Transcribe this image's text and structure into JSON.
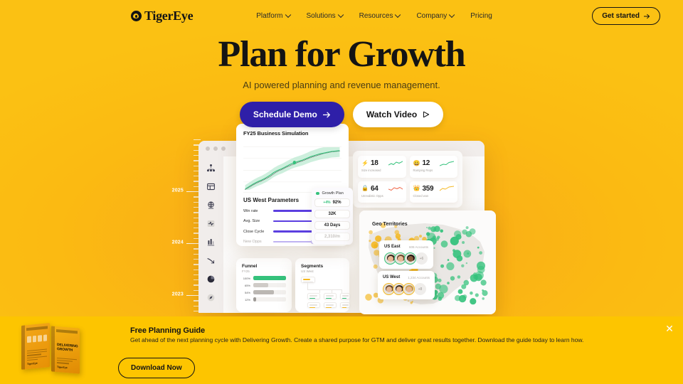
{
  "theme": {
    "bg_yellow": "#FBC113",
    "banner_yellow": "#FDC500",
    "accent_purple": "#2E1FA8",
    "accent_green": "#35C27C",
    "ink": "#141414"
  },
  "nav": {
    "brand": "TigerEye",
    "brand_icon": "tiger-eye-logo-icon",
    "links": [
      {
        "label": "Platform",
        "has_dropdown": true
      },
      {
        "label": "Solutions",
        "has_dropdown": true
      },
      {
        "label": "Resources",
        "has_dropdown": true
      },
      {
        "label": "Company",
        "has_dropdown": true
      },
      {
        "label": "Pricing",
        "has_dropdown": false
      }
    ],
    "cta": {
      "label": "Get started",
      "icon": "arrow-right-icon"
    }
  },
  "hero": {
    "title": "Plan for Growth",
    "subtitle": "AI powered planning and revenue management.",
    "primary_cta": {
      "label": "Schedule Demo",
      "icon": "arrow-right-icon"
    },
    "secondary_cta": {
      "label": "Watch Video",
      "icon": "play-icon"
    }
  },
  "timeline": {
    "labels": [
      "2025",
      "2024",
      "2023"
    ]
  },
  "dashboard": {
    "window_dots": 3,
    "rail_icons": [
      "org-chart-icon",
      "table-icon",
      "globe-target-icon",
      "pulse-activity-icon",
      "bar-chart-icon",
      "trend-down-icon",
      "pie-chart-icon",
      "compass-icon",
      "people-group-icon",
      "settings-gear-icon"
    ],
    "simulation": {
      "title": "FY25 Business Simulation",
      "chart": {
        "type": "line",
        "series_name": "Growth Plan",
        "band_color": "#B8E9CE",
        "line_color": "#35C27C",
        "actual_points": [
          2,
          8,
          14,
          19,
          23,
          28,
          34,
          41,
          46,
          50,
          55,
          60,
          64,
          67,
          70,
          74,
          78,
          81,
          84,
          86,
          88,
          90,
          91,
          92
        ],
        "plan_points": [
          1,
          6,
          12,
          17,
          21,
          26,
          31,
          38,
          44,
          48,
          53,
          57,
          61,
          65,
          68,
          72,
          76,
          79,
          82,
          85,
          87,
          89,
          90,
          91
        ],
        "marker_index": 12
      },
      "params_title": "US West Parameters",
      "legend_label": "Growth Plan",
      "parameters": [
        {
          "label": "Win rate",
          "fill_pct": 78,
          "delta": "+4%",
          "value": "92%",
          "muted": false
        },
        {
          "label": "Avg. Size",
          "fill_pct": 64,
          "delta": "",
          "value": "32K",
          "muted": false
        },
        {
          "label": "Close Cycle",
          "fill_pct": 82,
          "delta": "",
          "value": "43 Days",
          "muted": false
        },
        {
          "label": "New Opps",
          "fill_pct": 58,
          "delta": "",
          "value": "2,310/m",
          "muted": true
        }
      ]
    },
    "metrics": [
      {
        "icon": "lightning-bolt-icon",
        "glyph": "⚡",
        "value": "18",
        "label": "Size increased",
        "spark_color": "#35C27C"
      },
      {
        "icon": "smiley-face-icon",
        "glyph": "😀",
        "value": "12",
        "label": "Ramping Reps",
        "spark_color": "#35C27C"
      },
      {
        "icon": "lock-icon",
        "glyph": "🔒",
        "value": "64",
        "label": "Unrealistic Opps",
        "spark_color": "#F06A4B"
      },
      {
        "icon": "crown-icon",
        "glyph": "👑",
        "value": "359",
        "label": "Closed won",
        "spark_color": "#F5B820"
      }
    ],
    "funnel": {
      "title": "Funnel",
      "subtitle": "FY25",
      "rows": [
        {
          "pct_label": "100%",
          "width": 100,
          "color": "#35C27C"
        },
        {
          "pct_label": "65%",
          "width": 45,
          "color": "#CFCBC7"
        },
        {
          "pct_label": "54%",
          "width": 62,
          "color": "#BBB7B3"
        },
        {
          "pct_label": "12%",
          "width": 9,
          "color": "#9E9A96"
        }
      ]
    },
    "segments": {
      "title": "Segments",
      "subtitle": "US West"
    },
    "geo": {
      "title": "Geo Territories",
      "territories": [
        {
          "name": "US East",
          "accounts": "608 Accounts",
          "more": "+6",
          "ring": "green"
        },
        {
          "name": "US West",
          "accounts": "1,234 Accounts",
          "more": "+8",
          "ring": "yellow"
        }
      ]
    }
  },
  "banner": {
    "title": "Free Planning Guide",
    "description": "Get ahead of the next planning cycle with Delivering Growth. Create a shared purpose for GTM and deliver great results together. Download the guide today to learn how.",
    "cta": "Download Now",
    "close_icon": "close-icon",
    "book_title": "DELIVERING GROWTH",
    "book_brand": "TigerEye"
  }
}
